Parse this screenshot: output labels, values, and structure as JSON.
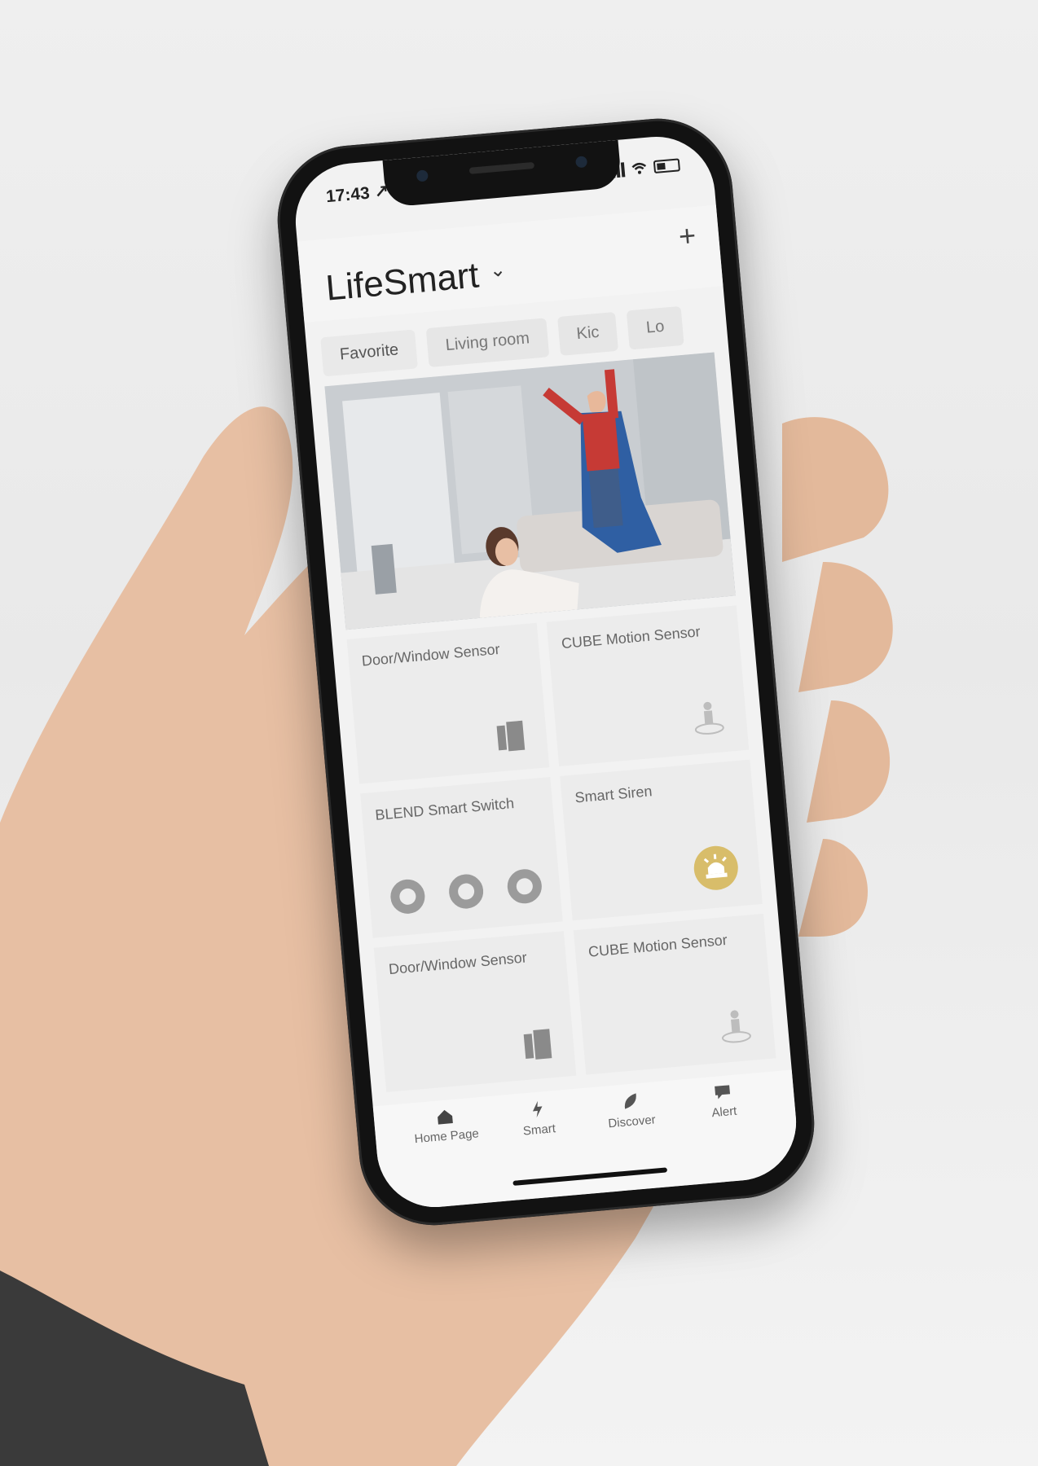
{
  "status_bar": {
    "time": "17:43 ↗"
  },
  "header": {
    "app_name": "LifeSmart",
    "add_button": "+"
  },
  "room_tabs": [
    "Favorite",
    "Living room",
    "Kic",
    "Lo"
  ],
  "devices": [
    {
      "title": "Door/Window Sensor",
      "icon": "door-sensor-icon"
    },
    {
      "title": "CUBE Motion Sensor",
      "icon": "motion-sensor-icon"
    },
    {
      "title": "BLEND Smart Switch",
      "icon": "switch-rings"
    },
    {
      "title": "Smart Siren",
      "icon": "siren-icon",
      "accent": "#d8bd6a"
    },
    {
      "title": "Door/Window Sensor",
      "icon": "door-sensor-icon"
    },
    {
      "title": "CUBE Motion Sensor",
      "icon": "motion-sensor-icon"
    }
  ],
  "tab_bar": [
    {
      "label": "Home Page",
      "icon": "home-icon"
    },
    {
      "label": "Smart",
      "icon": "lightning-icon"
    },
    {
      "label": "Discover",
      "icon": "leaf-icon"
    },
    {
      "label": "Alert",
      "icon": "chat-icon"
    }
  ]
}
